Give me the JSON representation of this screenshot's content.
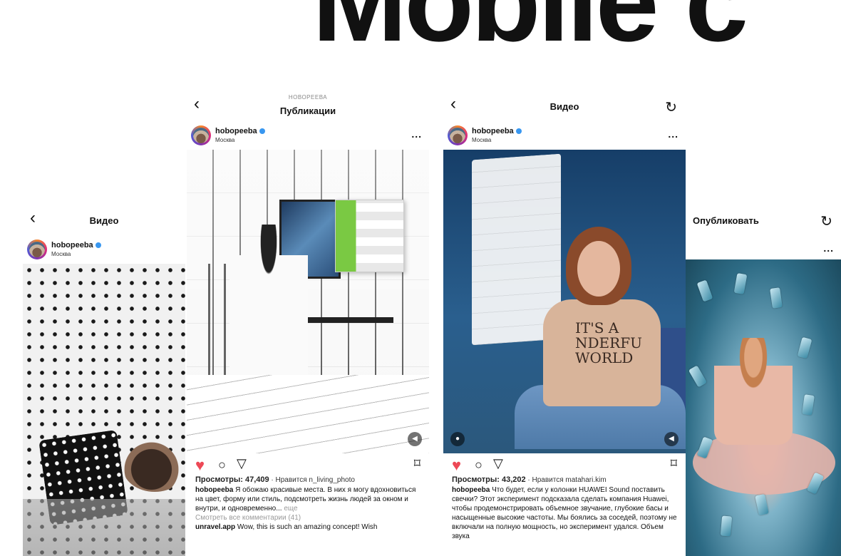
{
  "hero_text": "Mobile c",
  "icons": {
    "back": "‹",
    "refresh": "↻",
    "more": "...",
    "heart": "♥",
    "comment": "○",
    "share": "▽",
    "save": "⌑",
    "volume": "◀",
    "user": "●"
  },
  "colors": {
    "heart": "#ed4956",
    "verified": "#3897f0"
  },
  "phone1": {
    "title": "Видео",
    "username": "hobopeeba",
    "location": "Москва"
  },
  "phone2": {
    "subtitle": "НОВОРЕЕВА",
    "title": "Публикации",
    "username": "hobopeeba",
    "location": "Москва",
    "views": "Просмотры: 47,409",
    "likes": " · Нравится n_living_photo",
    "caption_user": "hobopeeba",
    "caption_text": " Я обожаю красивые места. В них я могу вдохновиться на цвет, форму или стиль, подсмотреть жизнь людей за окном и внутри, и одновременно...",
    "more": " еще",
    "view_comments": "Смотреть все комментарии (41)",
    "comment_user": "unravel.app",
    "comment_text": " Wow, this is such an amazing concept! Wish"
  },
  "phone3": {
    "title": "Видео",
    "username": "hobopeeba",
    "location": "Москва",
    "sweater_text": "IT'S A\nNDERFU\nWORLD",
    "views": "Просмотры: 43,202",
    "likes": " · Нравится matahari.kim",
    "caption_user": "hobopeeba",
    "caption_text": " Что будет, если у колонки HUAWEI Sound поставить свечки? Этот эксперимент подсказала сделать компания Huawei, чтобы продемонстрировать объемное звучание, глубокие басы и насыщенные высокие частоты. Мы боялись за соседей, поэтому не включали на полную мощность, но эксперимент удался. Объем звука"
  },
  "phone4": {
    "title": "Опубликовать"
  }
}
